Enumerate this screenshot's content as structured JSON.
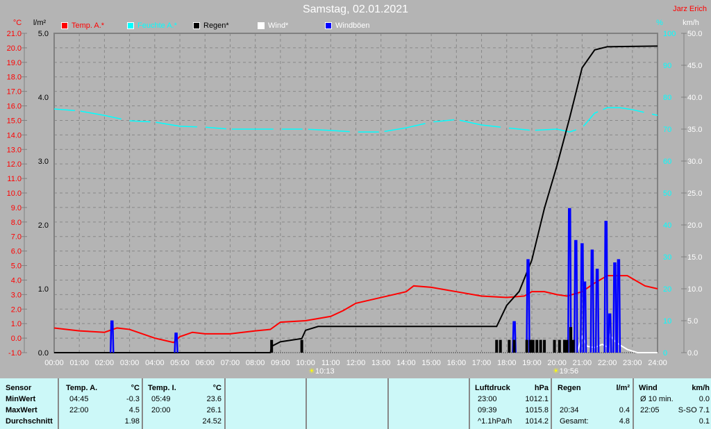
{
  "header": {
    "title": "Samstag, 02.01.2021",
    "author": "Jarz Erich"
  },
  "legend": [
    {
      "label": "Temp. A.*",
      "color": "#ff0000"
    },
    {
      "label": "Feuchte A.*",
      "color": "#00ffff"
    },
    {
      "label": "Regen*",
      "color": "#000000"
    },
    {
      "label": "Wind*",
      "color": "#ffffff"
    },
    {
      "label": "Windböen",
      "color": "#0000ff"
    }
  ],
  "chart_data": {
    "type": "line",
    "title": "Samstag, 02.01.2021",
    "x_unit": "hour",
    "xlim": [
      0,
      24
    ],
    "x_ticks": [
      "00:00",
      "01:00",
      "02:00",
      "03:00",
      "04:00",
      "05:00",
      "06:00",
      "07:00",
      "08:00",
      "09:00",
      "10:00",
      "11:00",
      "12:00",
      "13:00",
      "14:00",
      "15:00",
      "16:00",
      "17:00",
      "18:00",
      "19:00",
      "20:00",
      "21:00",
      "22:00",
      "23:00",
      "24:00"
    ],
    "axes": {
      "temp": {
        "unit": "°C",
        "range": [
          -1,
          21
        ],
        "ticks": [
          "21.0",
          "20.0",
          "19.0",
          "18.0",
          "17.0",
          "16.0",
          "15.0",
          "14.0",
          "13.0",
          "12.0",
          "11.0",
          "10.0",
          "9.0",
          "8.0",
          "7.0",
          "6.0",
          "5.0",
          "4.0",
          "3.0",
          "2.0",
          "1.0",
          "0.0",
          "-1.0"
        ]
      },
      "rain": {
        "unit": "l/m²",
        "range": [
          0,
          5
        ],
        "ticks": [
          "5.0",
          "4.0",
          "3.0",
          "2.0",
          "1.0",
          "0.0"
        ]
      },
      "humidity": {
        "unit": "%",
        "range": [
          0,
          100
        ],
        "ticks": [
          "100",
          "90",
          "80",
          "70",
          "60",
          "50",
          "40",
          "30",
          "20",
          "10",
          "0"
        ]
      },
      "wind": {
        "unit": "km/h",
        "range": [
          0,
          50
        ],
        "ticks": [
          "50.0",
          "45.0",
          "40.0",
          "35.0",
          "30.0",
          "25.0",
          "20.0",
          "15.0",
          "10.0",
          "5.0",
          "0.0"
        ]
      }
    },
    "markers": [
      {
        "label": "10:13",
        "hour": 10.22,
        "icon": "sunrise"
      },
      {
        "label": "19:56",
        "hour": 19.93,
        "icon": "sunset"
      }
    ],
    "series": [
      {
        "name": "Temp. A.*",
        "axis": "temp",
        "color": "#ff0000",
        "points": [
          [
            0,
            0.7
          ],
          [
            1,
            0.5
          ],
          [
            2,
            0.4
          ],
          [
            2.5,
            0.7
          ],
          [
            3,
            0.6
          ],
          [
            3.5,
            0.3
          ],
          [
            4,
            0.0
          ],
          [
            4.75,
            -0.3
          ],
          [
            5,
            0.1
          ],
          [
            5.5,
            0.4
          ],
          [
            6,
            0.3
          ],
          [
            7,
            0.3
          ],
          [
            8,
            0.5
          ],
          [
            8.6,
            0.6
          ],
          [
            9,
            1.1
          ],
          [
            10,
            1.2
          ],
          [
            11,
            1.5
          ],
          [
            11.5,
            1.9
          ],
          [
            12,
            2.4
          ],
          [
            13,
            2.8
          ],
          [
            14,
            3.2
          ],
          [
            14.3,
            3.6
          ],
          [
            15,
            3.5
          ],
          [
            16,
            3.2
          ],
          [
            17,
            2.9
          ],
          [
            18,
            2.8
          ],
          [
            18.7,
            2.9
          ],
          [
            19,
            3.2
          ],
          [
            19.5,
            3.2
          ],
          [
            20,
            3.0
          ],
          [
            20.4,
            2.9
          ],
          [
            21,
            3.2
          ],
          [
            21.5,
            3.8
          ],
          [
            22,
            4.3
          ],
          [
            22.8,
            4.3
          ],
          [
            23,
            4.1
          ],
          [
            23.5,
            3.6
          ],
          [
            24,
            3.4
          ]
        ]
      },
      {
        "name": "Feuchte A.*",
        "axis": "humidity",
        "color": "#00ffff",
        "points": [
          [
            0,
            76.3
          ],
          [
            1,
            75.7
          ],
          [
            2,
            74.3
          ],
          [
            3,
            72.6
          ],
          [
            4,
            72.2
          ],
          [
            5,
            70.9
          ],
          [
            6,
            70.6
          ],
          [
            7,
            70
          ],
          [
            8,
            70
          ],
          [
            9,
            70
          ],
          [
            10,
            70
          ],
          [
            11,
            69.6
          ],
          [
            12,
            69.1
          ],
          [
            13,
            69.1
          ],
          [
            14,
            70.4
          ],
          [
            15,
            72.2
          ],
          [
            16,
            73
          ],
          [
            17,
            71.3
          ],
          [
            18,
            70.4
          ],
          [
            19,
            69.6
          ],
          [
            20,
            70
          ],
          [
            20.5,
            69.1
          ],
          [
            21,
            70.4
          ],
          [
            21.5,
            75
          ],
          [
            22,
            76.7
          ],
          [
            22.5,
            76.7
          ],
          [
            23,
            76.1
          ],
          [
            24,
            74.3
          ]
        ]
      },
      {
        "name": "Regen*",
        "axis": "rain",
        "color": "#000000",
        "points": [
          [
            0,
            0
          ],
          [
            8.6,
            0
          ],
          [
            8.65,
            0.1
          ],
          [
            9,
            0.17
          ],
          [
            9.5,
            0.2
          ],
          [
            9.85,
            0.22
          ],
          [
            10,
            0.35
          ],
          [
            10.5,
            0.41
          ],
          [
            17.6,
            0.41
          ],
          [
            18,
            0.74
          ],
          [
            18.5,
            0.96
          ],
          [
            19,
            1.45
          ],
          [
            19.5,
            2.26
          ],
          [
            20,
            2.93
          ],
          [
            20.5,
            3.67
          ],
          [
            21,
            4.46
          ],
          [
            21.5,
            4.74
          ],
          [
            22,
            4.79
          ],
          [
            24,
            4.8
          ]
        ]
      },
      {
        "name": "Wind*",
        "axis": "wind",
        "color": "#ffffff",
        "points": [
          [
            20.8,
            0
          ],
          [
            21,
            2.5
          ],
          [
            21.2,
            1
          ],
          [
            21.5,
            0.8
          ],
          [
            21.8,
            1.3
          ],
          [
            22,
            0.9
          ],
          [
            22.1,
            2.8
          ],
          [
            22.3,
            1.8
          ],
          [
            22.5,
            1.2
          ],
          [
            22.8,
            0.5
          ],
          [
            23.2,
            0
          ],
          [
            24,
            0
          ]
        ]
      },
      {
        "name": "Windböen",
        "axis": "wind",
        "color": "#0000ff",
        "spikes": [
          [
            2.3,
            4.9
          ],
          [
            4.85,
            3.0
          ],
          [
            18.3,
            4.8
          ],
          [
            18.85,
            14.5
          ],
          [
            20.5,
            22.5
          ],
          [
            20.75,
            17.5
          ],
          [
            21.0,
            17
          ],
          [
            21.1,
            11
          ],
          [
            21.4,
            16
          ],
          [
            21.6,
            13
          ],
          [
            21.95,
            20.5
          ],
          [
            22.1,
            6
          ],
          [
            22.3,
            14
          ],
          [
            22.45,
            14.5
          ]
        ]
      },
      {
        "name": "Regenrate",
        "axis": "rain",
        "color": "#000000",
        "bars": [
          [
            8.65,
            0.2
          ],
          [
            9.85,
            0.2
          ],
          [
            17.6,
            0.2
          ],
          [
            17.75,
            0.2
          ],
          [
            18.1,
            0.2
          ],
          [
            18.3,
            0.2
          ],
          [
            18.8,
            0.2
          ],
          [
            18.95,
            0.2
          ],
          [
            19.05,
            0.2
          ],
          [
            19.2,
            0.2
          ],
          [
            19.35,
            0.2
          ],
          [
            19.5,
            0.2
          ],
          [
            19.9,
            0.2
          ],
          [
            20.1,
            0.2
          ],
          [
            20.3,
            0.2
          ],
          [
            20.4,
            0.2
          ],
          [
            20.55,
            0.4
          ],
          [
            20.65,
            0.2
          ]
        ]
      }
    ]
  },
  "table": {
    "temp_a": {
      "h": [
        "Sensor",
        "Temp. A.",
        "°C"
      ],
      "rows": [
        [
          "MinWert",
          "04:45",
          "-0.3"
        ],
        [
          "MaxWert",
          "22:00",
          "4.5"
        ],
        [
          "Durchschnitt",
          "",
          "1.98"
        ]
      ]
    },
    "temp_i": {
      "h": [
        "Temp. I.",
        "°C"
      ],
      "rows": [
        [
          "05:49",
          "23.6"
        ],
        [
          "20:00",
          "26.1"
        ],
        [
          "",
          "24.52"
        ]
      ]
    },
    "luft": {
      "h": [
        "Luftdruck",
        "hPa"
      ],
      "rows": [
        [
          "23:00",
          "1012.1"
        ],
        [
          "09:39",
          "1015.8"
        ],
        [
          "^1.1hPa/h",
          "1014.2"
        ]
      ]
    },
    "regen": {
      "h": [
        "Regen",
        "l/m²"
      ],
      "rows": [
        [
          "",
          ""
        ],
        [
          "20:34",
          "0.4"
        ],
        [
          "Gesamt:",
          "4.8"
        ]
      ]
    },
    "wind": {
      "h": [
        "Wind",
        "km/h"
      ],
      "rows": [
        [
          "Ø 10 min.",
          "0.0"
        ],
        [
          "22:05",
          "S-SO 7.1"
        ],
        [
          "",
          "0.1"
        ]
      ]
    }
  }
}
